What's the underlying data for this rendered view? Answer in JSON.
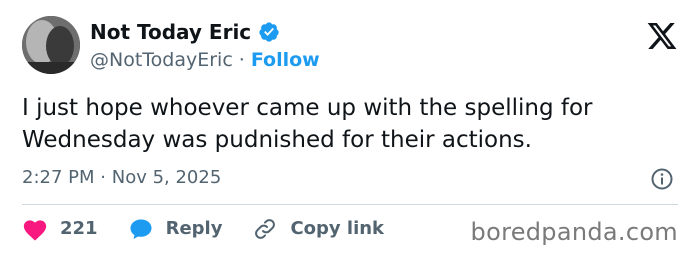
{
  "author": {
    "display_name": "Not Today Eric",
    "handle": "@NotTodayEric",
    "separator": "·",
    "follow_label": "Follow",
    "verified_icon": "verified-badge-icon",
    "verified_color": "#1d9bf0"
  },
  "platform_icon": "x-logo-icon",
  "tweet": {
    "text": "I just hope whoever came up with the spelling for Wednesday was pudnished for their actions.",
    "time": "2:27 PM",
    "separator": "·",
    "date": "Nov 5, 2025",
    "info_icon": "info-icon"
  },
  "actions": {
    "likes_count": "221",
    "like_icon": "heart-icon",
    "like_color": "#f91880",
    "reply_label": "Reply",
    "reply_icon": "speech-bubble-icon",
    "reply_icon_color": "#1d9bf0",
    "copy_link_label": "Copy link",
    "copy_link_icon": "link-icon"
  },
  "watermark": "boredpanda.com"
}
